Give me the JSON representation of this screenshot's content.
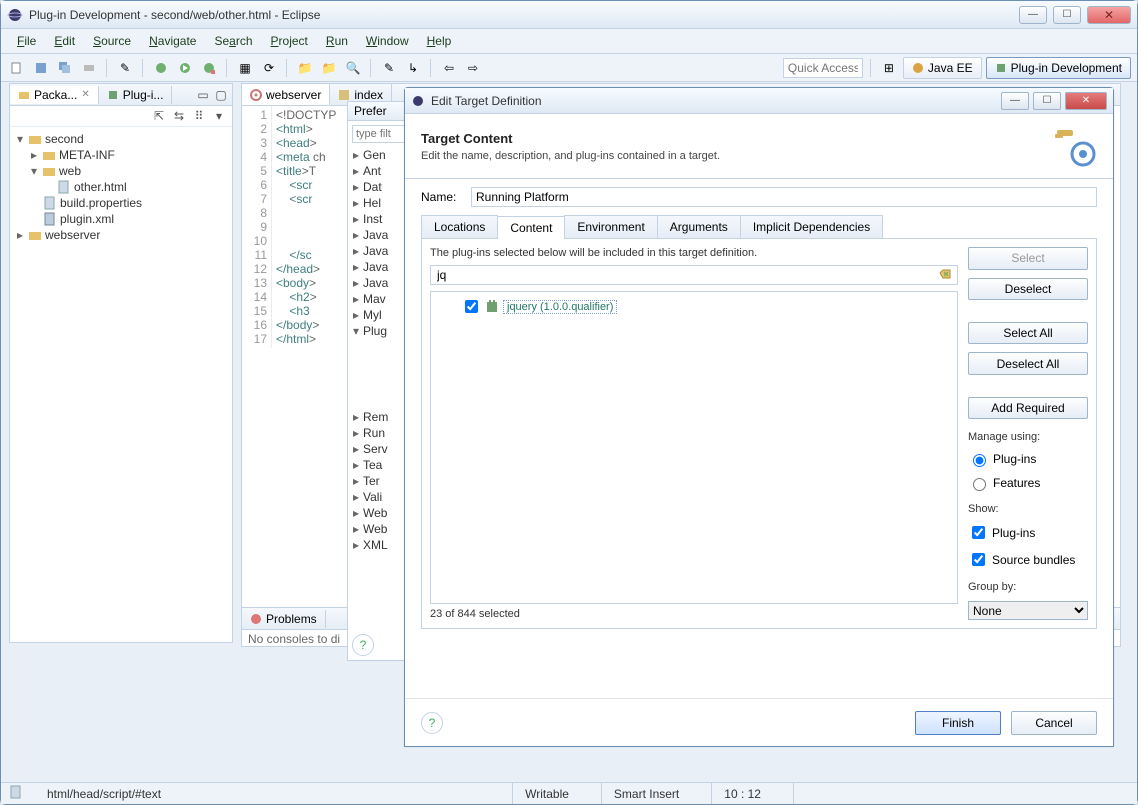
{
  "window_title": "Plug-in Development - second/web/other.html - Eclipse",
  "menus": [
    "File",
    "Edit",
    "Source",
    "Navigate",
    "Search",
    "Project",
    "Run",
    "Window",
    "Help"
  ],
  "quick_access_placeholder": "Quick Access",
  "perspectives": {
    "javaee": "Java EE",
    "plugin": "Plug-in Development"
  },
  "views": {
    "package_tab": "Packa...",
    "plugins_tab": "Plug-i...",
    "editor_tab": "webserver",
    "editor_tab2": "index",
    "problems_tab": "Problems",
    "console_empty": "No consoles to di"
  },
  "tree": {
    "project1": "second",
    "metainf": "META-INF",
    "webfolder": "web",
    "otherhtml": "other.html",
    "buildprops": "build.properties",
    "pluginxml": "plugin.xml",
    "project2": "webserver"
  },
  "gutter": [
    "1",
    "2",
    "3",
    "4",
    "5",
    "6",
    "7",
    "8",
    "9",
    "10",
    "11",
    "12",
    "13",
    "14",
    "15",
    "16",
    "17"
  ],
  "code_lines": [
    "<!DOCTYP",
    "<html>",
    "<head>",
    "<meta ch",
    "<title>T",
    "    <scr",
    "    <scr",
    "",
    "",
    "",
    "    </sc",
    "</head>",
    "<body>",
    "    <h2>",
    "    <h3",
    "</body>",
    "</html>"
  ],
  "pref": {
    "title": "Prefer",
    "filter_placeholder": "type filt",
    "items": [
      "Gen",
      "Ant",
      "Dat",
      "Hel",
      "Inst",
      "Java",
      "Java",
      "Java",
      "Java",
      "Mav",
      "Myl",
      "Plug",
      "",
      "",
      "",
      "",
      "",
      "Rem",
      "Run",
      "Serv",
      "Tea",
      "Ter",
      "Vali",
      "Web",
      "Web",
      "XML"
    ]
  },
  "dialog": {
    "title": "Edit Target Definition",
    "header_title": "Target Content",
    "header_desc": "Edit the name, description, and plug-ins contained in a target.",
    "name_label": "Name:",
    "name_value": "Running Platform",
    "tabs": [
      "Locations",
      "Content",
      "Environment",
      "Arguments",
      "Implicit Dependencies"
    ],
    "active_tab": "Content",
    "plugins_desc": "The plug-ins selected below will be included in this target definition.",
    "filter_value": "jq",
    "plugin_entry": "jquery (1.0.0.qualifier)",
    "selected_count": "23 of 844 selected",
    "buttons": {
      "select": "Select",
      "deselect": "Deselect",
      "select_all": "Select All",
      "deselect_all": "Deselect All",
      "add_required": "Add Required"
    },
    "manage_label": "Manage using:",
    "manage_plugins": "Plug-ins",
    "manage_features": "Features",
    "show_label": "Show:",
    "show_plugins": "Plug-ins",
    "show_source": "Source bundles",
    "group_by_label": "Group by:",
    "group_by_value": "None",
    "finish": "Finish",
    "cancel": "Cancel"
  },
  "status": {
    "path": "html/head/script/#text",
    "writable": "Writable",
    "insert": "Smart Insert",
    "cursor": "10 : 12"
  }
}
